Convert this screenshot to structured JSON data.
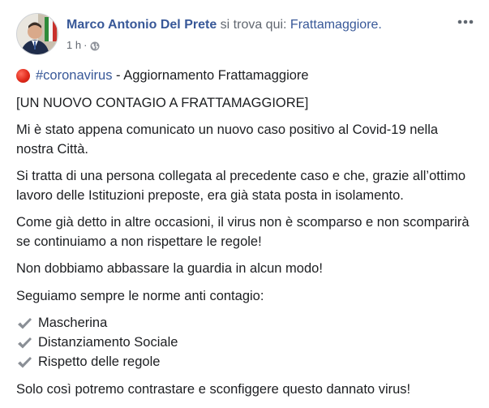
{
  "post": {
    "author": {
      "name": "Marco Antonio Del Prete",
      "status": " si trova qui: ",
      "place": "Frattamaggiore."
    },
    "meta": {
      "time": "1 h",
      "separator": "·",
      "privacy_icon": "globe-icon"
    },
    "menu_icon": "more-icon",
    "content": {
      "tag_line": {
        "icon": "red-circle-icon",
        "hashtag": "#coronavirus",
        "text": " - Aggiornamento Frattamaggiore"
      },
      "paragraphs": [
        "[UN NUOVO CONTAGIO A FRATTAMAGGIORE]",
        "Mi è stato appena comunicato un nuovo caso positivo al Covid-19 nella nostra Città.",
        "Si tratta di una persona collegata al precedente caso e che, grazie all’ottimo lavoro delle Istituzioni preposte, era già stata posta in isolamento.",
        "Come già detto in altre occasioni, il virus non è scomparso e non scomparirà se continuiamo a non rispettare le regole!",
        "Non dobbiamo abbassare la guardia in alcun modo!",
        "Seguiamo sempre le norme anti contagio:"
      ],
      "checklist": [
        "Mascherina",
        "Distanziamento Sociale",
        "Rispetto delle regole"
      ],
      "closing": "Solo così potremo contrastare e sconfiggere questo dannato virus!"
    }
  }
}
